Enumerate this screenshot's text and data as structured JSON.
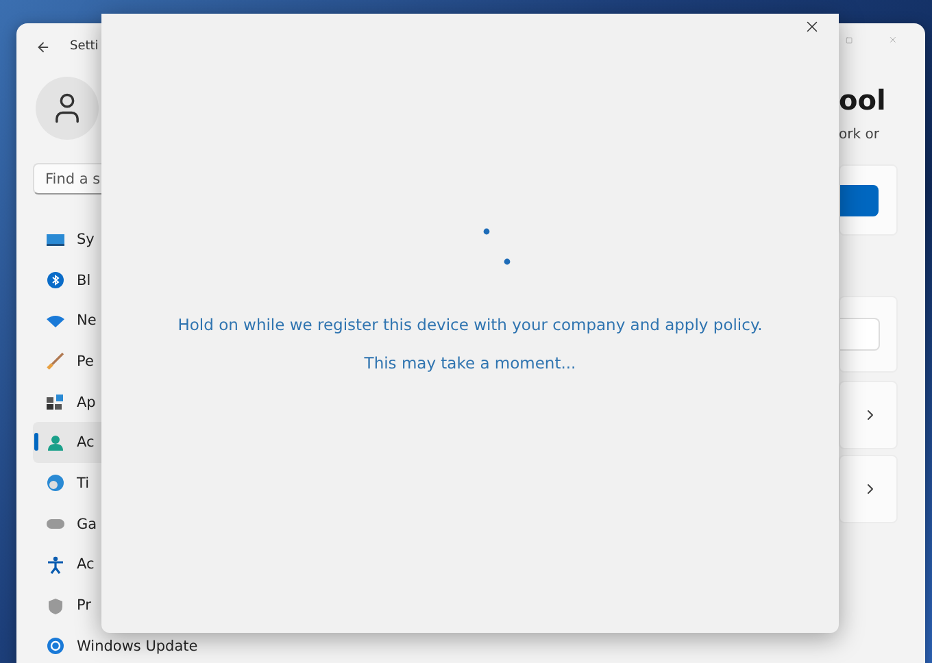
{
  "settings_window": {
    "title": "Setti",
    "search": {
      "placeholder": "Find a s"
    },
    "nav_items": [
      {
        "label": "Sy",
        "kind": "system",
        "selected": false
      },
      {
        "label": "Bl",
        "kind": "bluetooth",
        "selected": false
      },
      {
        "label": "Ne",
        "kind": "network",
        "selected": false
      },
      {
        "label": "Pe",
        "kind": "personalization",
        "selected": false
      },
      {
        "label": "Ap",
        "kind": "apps",
        "selected": false
      },
      {
        "label": "Ac",
        "kind": "accounts",
        "selected": true
      },
      {
        "label": "Ti",
        "kind": "time",
        "selected": false
      },
      {
        "label": "Ga",
        "kind": "gaming",
        "selected": false
      },
      {
        "label": "Ac",
        "kind": "accessibility",
        "selected": false
      },
      {
        "label": "Pr",
        "kind": "privacy",
        "selected": false
      },
      {
        "label": "Windows Update",
        "kind": "update",
        "selected": false
      }
    ],
    "page_title": "ool",
    "description": "ork or"
  },
  "dialog": {
    "message": "Hold on while we register this device with your company and apply policy.",
    "submessage": "This may take a moment..."
  }
}
